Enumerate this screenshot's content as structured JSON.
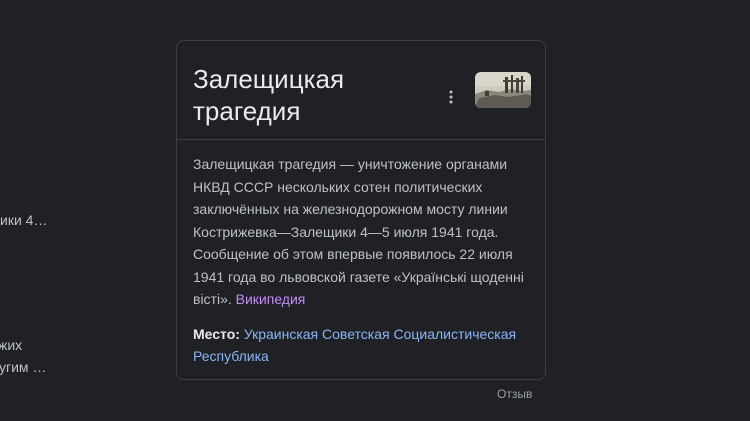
{
  "left_column": {
    "snippet_1": "ики 4…",
    "snippet_2": "жих",
    "snippet_3": "угим …"
  },
  "knowledge_panel": {
    "title_line_1": "Залещицкая",
    "title_line_2": "трагедия",
    "more_icon": "more-vert-icon",
    "description": "Залещицкая трагедия — уничтожение органами НКВД СССР нескольких сотен политических заключённых на железнодорожном мосту линии Кострижевка—Залещики 4—5 июля 1941 года. Сообщение об этом впервые появилось 22 июля 1941 года во львовской газете «Українські щоденні вісті».",
    "source_link": "Википедия",
    "facts": [
      {
        "label": "Место:",
        "value": "Украинская Советская Социалистическая Республика"
      }
    ]
  },
  "feedback_label": "Отзыв",
  "colors": {
    "background": "#202124",
    "border": "#3c4043",
    "title": "#e8eaed",
    "text": "#bdc1c6",
    "link": "#8ab4f8",
    "visited_link": "#c58af9"
  }
}
